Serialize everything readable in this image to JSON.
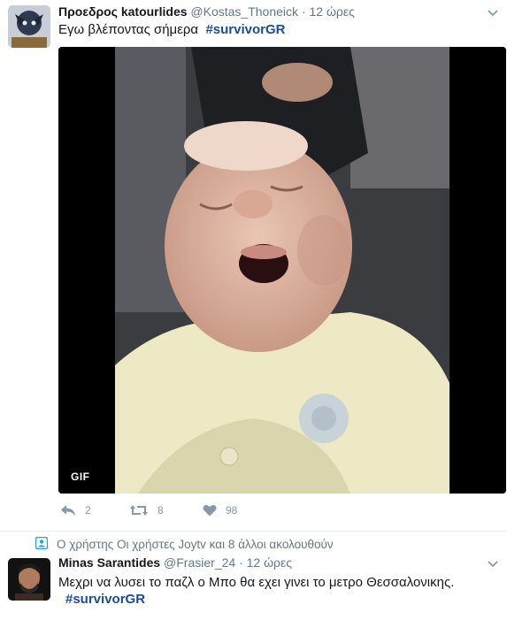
{
  "tweets": [
    {
      "author_name": "Προεδρος katourlides",
      "handle": "@Kostas_Thoneick",
      "separator": "·",
      "time": "12 ώρες",
      "text": "Εγω βλέποντας σήμερα",
      "hashtag": "#survivorGR",
      "media_badge": "GIF",
      "actions": {
        "reply_count": "2",
        "retweet_count": "8",
        "like_count": "98"
      }
    },
    {
      "context": "Ο χρήστης Οι χρήστες Joytv και 8 άλλοι ακολουθούν",
      "author_name": "Minas Sarantides",
      "handle": "@Frasier_24",
      "separator": "·",
      "time": "12 ώρες",
      "text": "Μεχρι να λυσει το παζλ ο Μπο θα εχει γινει το μετρο Θεσσαλονικης.",
      "hashtag": "#survivorGR"
    }
  ],
  "colors": {
    "hashtag": "#1b4b9a",
    "muted": "#657786",
    "icon": "#8899a6",
    "context_icon": "#1da1f2"
  },
  "icons": [
    "reply-icon",
    "retweet-icon",
    "like-icon",
    "more-caret-icon",
    "follow-context-icon",
    "gif-badge"
  ]
}
